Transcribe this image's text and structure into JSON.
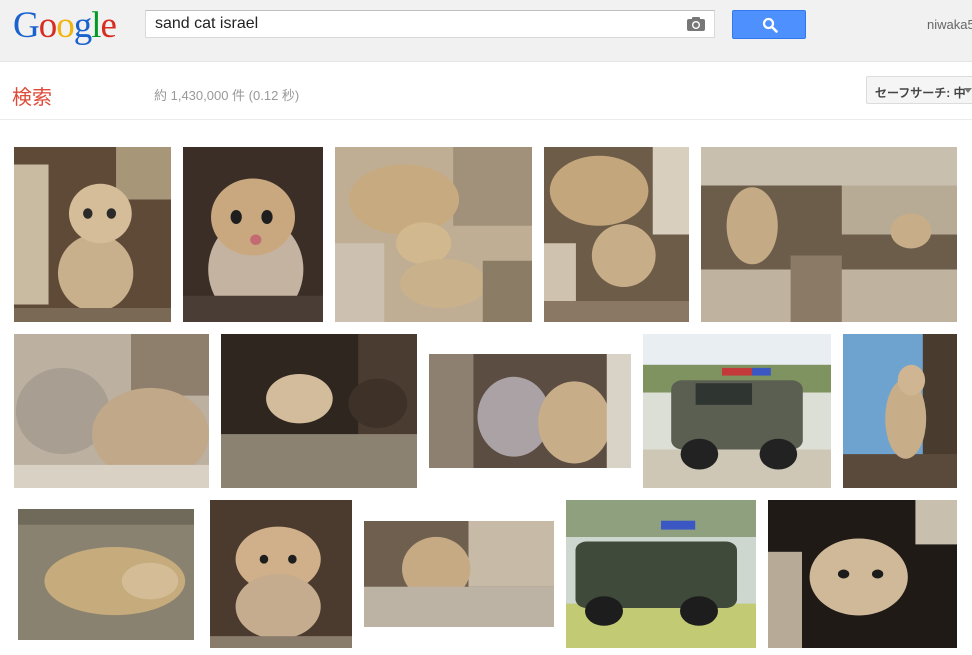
{
  "header": {
    "logo_letters": [
      {
        "ch": "G",
        "color": "#1a62ce"
      },
      {
        "ch": "o",
        "color": "#d62d20"
      },
      {
        "ch": "o",
        "color": "#f2b50f"
      },
      {
        "ch": "g",
        "color": "#1a62ce"
      },
      {
        "ch": "l",
        "color": "#009925"
      },
      {
        "ch": "e",
        "color": "#d62d20"
      }
    ],
    "search_value": "sand cat israel",
    "user": "niwaka5"
  },
  "subbar": {
    "title": "検索",
    "result_stats": "約 1,430,000 件 (0.12 秒)",
    "safesearch_label": "セーフサーチ: 中"
  },
  "colors": {
    "accent_red": "#dd4b39",
    "search_button": "#4d90fe"
  },
  "images": [
    {
      "row": 1,
      "subject": "sand-cat-kitten-in-rocks"
    },
    {
      "row": 1,
      "subject": "sand-cat-kitten-licking"
    },
    {
      "row": 1,
      "subject": "sand-cat-mother-and-kitten"
    },
    {
      "row": 1,
      "subject": "sand-cat-mother-and-kitten"
    },
    {
      "row": 1,
      "subject": "sand-cat-on-rocks"
    },
    {
      "row": 2,
      "subject": "two-sand-cat-kittens"
    },
    {
      "row": 2,
      "subject": "sand-cat-kitten-dark"
    },
    {
      "row": 2,
      "subject": "two-sand-cat-kittens"
    },
    {
      "row": 2,
      "subject": "police-armored-vehicle"
    },
    {
      "row": 2,
      "subject": "sand-cat-sitting-sky"
    },
    {
      "row": 3,
      "subject": "sand-cat-sleeping"
    },
    {
      "row": 3,
      "subject": "sand-cat-kitten-in-rocks"
    },
    {
      "row": 3,
      "subject": "sand-cat-kitten-by-rock"
    },
    {
      "row": 3,
      "subject": "police-armored-vehicle-driving"
    },
    {
      "row": 3,
      "subject": "sand-cat-kitten-closeup"
    }
  ]
}
